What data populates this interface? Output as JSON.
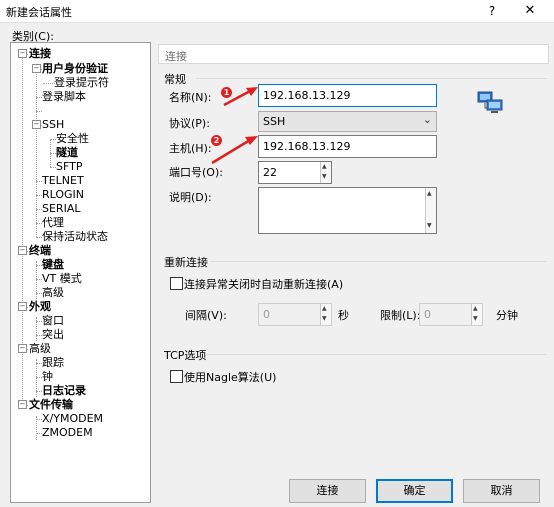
{
  "window": {
    "title": "新建会话属性",
    "help_glyph": "?",
    "close_glyph": "✕"
  },
  "category_label": "类别(C):",
  "tree": {
    "conn": "连接",
    "user_auth": "用户身份验证",
    "login_prompt": "登录提示符",
    "login_script": "登录脚本",
    "ssh": "SSH",
    "security": "安全性",
    "tunnel": "隧道",
    "sftp": "SFTP",
    "telnet": "TELNET",
    "rlogin": "RLOGIN",
    "serial": "SERIAL",
    "proxy": "代理",
    "keepalive": "保持活动状态",
    "terminal": "终端",
    "keyboard": "键盘",
    "vt_mode": "VT 模式",
    "term_adv": "高级",
    "appearance": "外观",
    "window": "窗口",
    "highlight": "突出",
    "advanced": "高级",
    "trace": "跟踪",
    "bell": "钟",
    "logging": "日志记录",
    "file_transfer": "文件传输",
    "xymodem": "X/YMODEM",
    "zmodem": "ZMODEM",
    "expander_minus": "−"
  },
  "section_title": "连接",
  "general": {
    "group": "常规",
    "name_label": "名称(N):",
    "name_value": "192.168.13.129",
    "protocol_label": "协议(P):",
    "protocol_value": "SSH",
    "host_label": "主机(H):",
    "host_value": "192.168.13.129",
    "port_label": "端口号(O):",
    "port_value": "22",
    "desc_label": "说明(D):",
    "badge1": "1",
    "badge2": "2"
  },
  "reconnect": {
    "group": "重新连接",
    "checkbox_label": "连接异常关闭时自动重新连接(A)",
    "interval_label": "间隔(V):",
    "interval_value": "0",
    "interval_unit": "秒",
    "limit_label": "限制(L):",
    "limit_value": "0",
    "limit_unit": "分钟"
  },
  "tcp": {
    "group": "TCP选项",
    "nagle_label": "使用Nagle算法(U)"
  },
  "buttons": {
    "connect": "连接",
    "ok": "确定",
    "cancel": "取消"
  },
  "colors": {
    "accent": "#0078d7",
    "arrow_red": "#e02020"
  },
  "icons": {
    "network": "network-computers-icon"
  }
}
